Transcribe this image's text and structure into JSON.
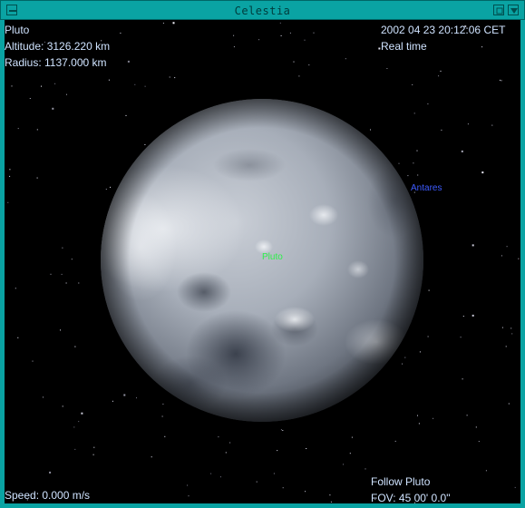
{
  "window": {
    "title": "Celestia"
  },
  "hud": {
    "top_left": [
      "Pluto",
      "Altitude: 3126.220 km",
      "Radius: 1137.000 km"
    ],
    "top_right": [
      "2002 04 23 20:12:06 CET",
      "Real time"
    ],
    "bottom_left": "Speed: 0.000 m/s",
    "bottom_right": [
      "Follow Pluto",
      "FOV: 45 00' 0.0\""
    ]
  },
  "labels": {
    "star": "Antares",
    "body": "Pluto"
  },
  "colors": {
    "frame": "#0aa3a3",
    "hud_text": "#cfe3ff",
    "star_label": "#3d5bff",
    "body_label": "#2ef04a"
  },
  "icons": {
    "window_menu": "window-menu-icon",
    "minimize": "minimize-icon",
    "close": "close-icon"
  }
}
